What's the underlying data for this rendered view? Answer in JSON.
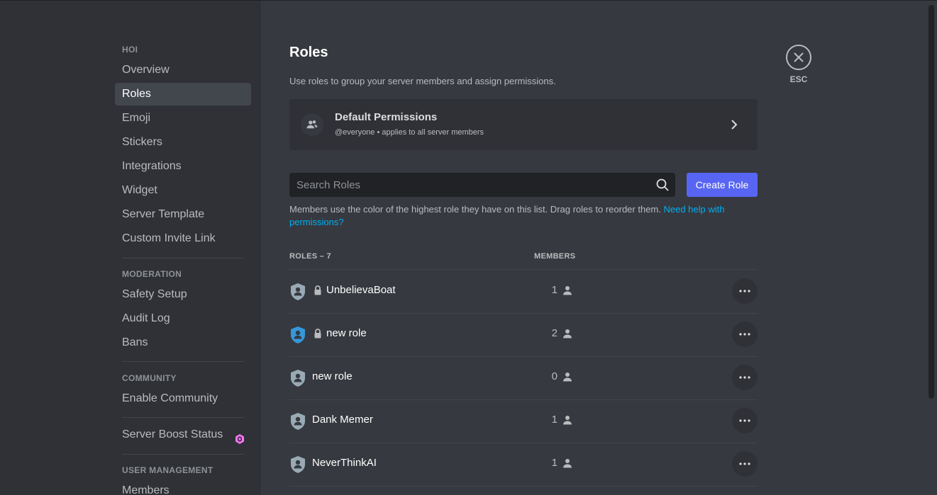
{
  "sidebar": {
    "server_name": "HOI",
    "items_main": [
      "Overview",
      "Roles",
      "Emoji",
      "Stickers",
      "Integrations",
      "Widget",
      "Server Template",
      "Custom Invite Link"
    ],
    "moderation_header": "MODERATION",
    "items_moderation": [
      "Safety Setup",
      "Audit Log",
      "Bans"
    ],
    "community_header": "COMMUNITY",
    "items_community": [
      "Enable Community"
    ],
    "boost_label": "Server Boost Status",
    "user_mgmt_header": "USER MANAGEMENT",
    "items_user_mgmt": [
      "Members"
    ]
  },
  "page": {
    "title": "Roles",
    "subtitle": "Use roles to group your server members and assign permissions.",
    "default_perms": {
      "title": "Default Permissions",
      "subtitle": "@everyone • applies to all server members"
    },
    "search_placeholder": "Search Roles",
    "create_button": "Create Role",
    "help_text": "Members use the color of the highest role they have on this list. Drag roles to reorder them. ",
    "help_link": "Need help with permissions?",
    "roles_header": "ROLES – 7",
    "members_header": "MEMBERS",
    "esc_label": "ESC"
  },
  "roles": [
    {
      "name": "UnbelievaBoat",
      "count": "1",
      "locked": true,
      "color": "#99aab5"
    },
    {
      "name": "new role",
      "count": "2",
      "locked": true,
      "color": "#3498db"
    },
    {
      "name": "new role",
      "count": "0",
      "locked": false,
      "color": "#99aab5"
    },
    {
      "name": "Dank Memer",
      "count": "1",
      "locked": false,
      "color": "#99aab5"
    },
    {
      "name": "NeverThinkAI",
      "count": "1",
      "locked": false,
      "color": "#99aab5"
    }
  ],
  "colors": {
    "accent": "#5865f2",
    "link": "#00aff4",
    "boost": "#ff73fa"
  },
  "icons": {
    "default_perms": "members-icon",
    "chevron": "chevron-right-icon",
    "search": "search-icon",
    "close": "close-icon",
    "role": "shield-person-icon",
    "lock": "lock-icon",
    "member": "person-icon",
    "more": "more-horizontal-icon",
    "boost": "boost-gem-icon"
  }
}
